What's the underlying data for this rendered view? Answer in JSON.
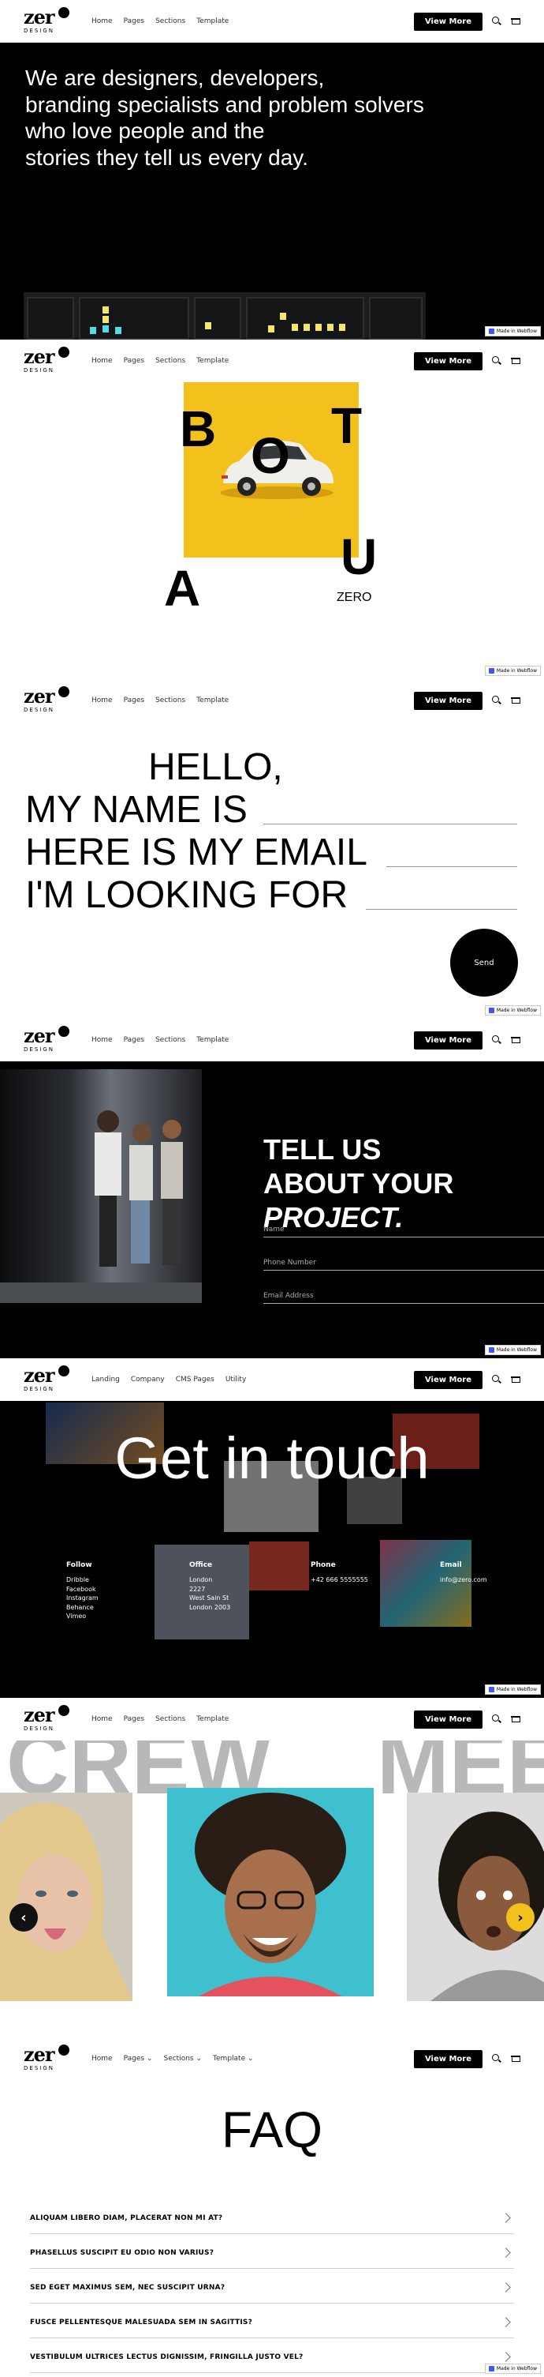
{
  "nav": {
    "logo_word": "zer",
    "logo_sub": "DESIGN",
    "links": [
      "Home",
      "Pages",
      "Sections",
      "Template"
    ],
    "links_alt": [
      "Landing",
      "Company",
      "CMS Pages",
      "Utility"
    ],
    "links_dropdown": [
      "Home",
      "Pages",
      "Sections",
      "Template"
    ],
    "cta": "View More",
    "webflow_badge": "Made in Webflow"
  },
  "hero": {
    "line1": "We are designers, developers,",
    "line2": "branding specialists and problem solvers",
    "line3": "who love people and the",
    "line4": "stories they tell us every day."
  },
  "about": {
    "letters": [
      "B",
      "O",
      "T",
      "A",
      "U"
    ],
    "zero_label": "ZERO"
  },
  "hello_form": {
    "line1": "HELLO,",
    "line2": "MY NAME IS",
    "line3": "HERE IS MY EMAIL",
    "line4": "I'M LOOKING FOR",
    "send": "Send"
  },
  "project": {
    "title1": "TELL US",
    "title2": "ABOUT YOUR",
    "title3": "PROJECT.",
    "fields": [
      "Name",
      "Phone Number",
      "Email Address"
    ]
  },
  "contact": {
    "headline": "Get in touch",
    "follow": {
      "title": "Follow",
      "items": [
        "Dribble",
        "Facebook",
        "Instagram",
        "Behance",
        "Vimeo"
      ]
    },
    "office": {
      "title": "Office",
      "items": [
        "London",
        "2227",
        "West Sain St",
        "London 2003"
      ]
    },
    "phone": {
      "title": "Phone",
      "value": "+42 666 5555555"
    },
    "email": {
      "title": "Email",
      "value": "info@zero.com"
    }
  },
  "crew": {
    "word_left": "CREW",
    "word_right": "MEE",
    "prev": "‹",
    "next": "›"
  },
  "faq": {
    "title": "FAQ",
    "questions": [
      "ALIQUAM LIBERO DIAM, PLACERAT NON MI AT?",
      "PHASELLUS SUSCIPIT EU ODIO NON VARIUS?",
      "SED EGET MAXIMUS SEM, NEC SUSCIPIT URNA?",
      "FUSCE PELLENTESQUE MALESUADA SEM IN SAGITTIS?",
      "VESTIBULUM ULTRICES LECTUS DIGNISSIM, FRINGILLA JUSTO VEL?"
    ]
  },
  "colors": {
    "accent_yellow": "#f3c11b",
    "dark": "#000000"
  }
}
